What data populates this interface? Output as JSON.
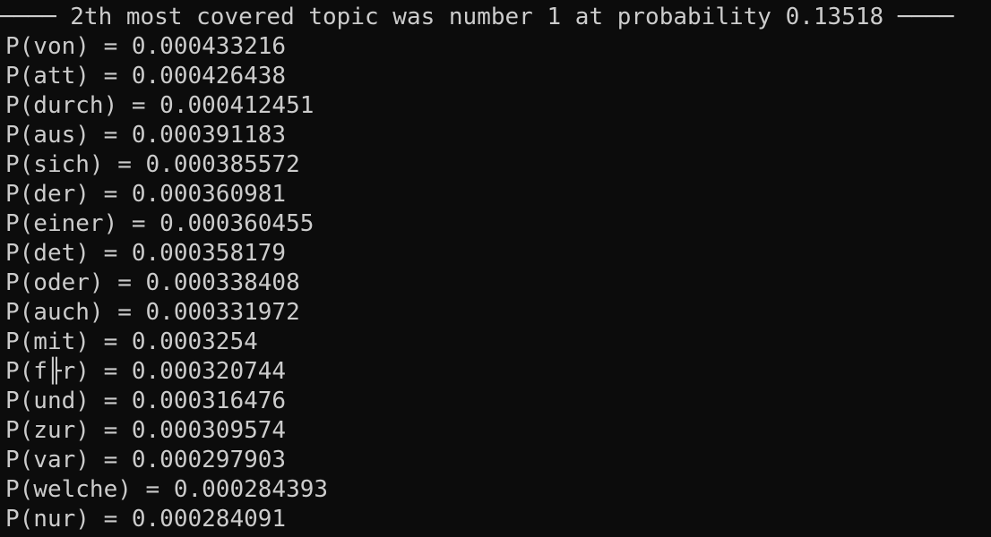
{
  "terminal": {
    "header": "──── 2th most covered topic was number 1 at probability 0.13518 ────",
    "lines": [
      "P(von) = 0.000433216",
      "P(att) = 0.000426438",
      "P(durch) = 0.000412451",
      "P(aus) = 0.000391183",
      "P(sich) = 0.000385572",
      "P(der) = 0.000360981",
      "P(einer) = 0.000360455",
      "P(det) = 0.000358179",
      "P(oder) = 0.000338408",
      "P(auch) = 0.000331972",
      "P(mit) = 0.0003254",
      "P(f╟r) = 0.000320744",
      "P(und) = 0.000316476",
      "P(zur) = 0.000309574",
      "P(var) = 0.000297903",
      "P(welche) = 0.000284393",
      "P(nur) = 0.000284091"
    ]
  }
}
